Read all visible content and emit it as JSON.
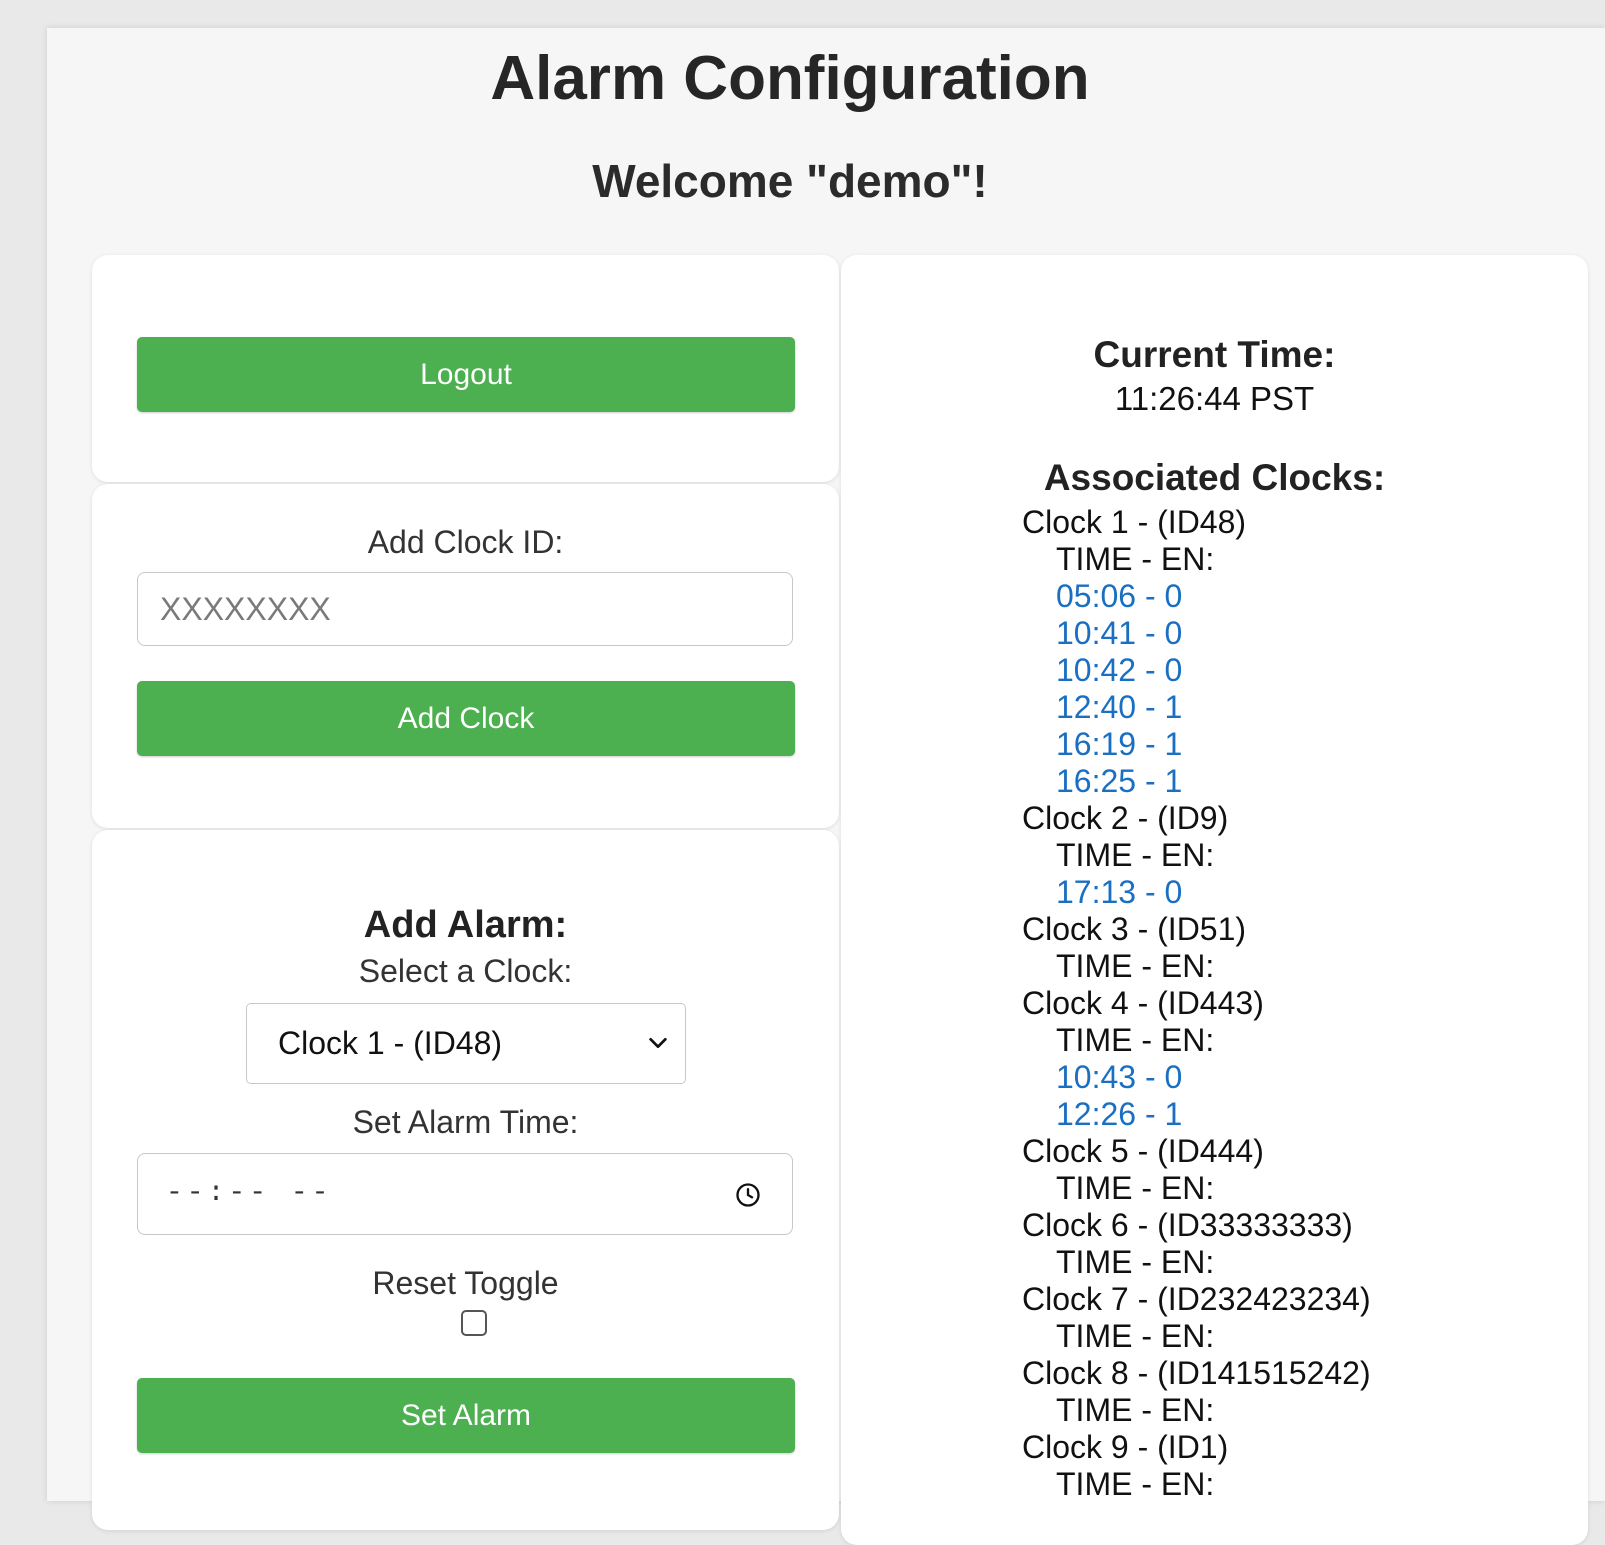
{
  "header": {
    "title": "Alarm Configuration",
    "welcome": "Welcome \"demo\"!"
  },
  "logout": {
    "button_label": "Logout"
  },
  "add_clock": {
    "label": "Add Clock ID:",
    "input_placeholder": "XXXXXXXX",
    "button_label": "Add Clock"
  },
  "add_alarm": {
    "heading": "Add Alarm:",
    "select_label": "Select a Clock:",
    "selected_clock": "Clock 1 - (ID48)",
    "time_label": "Set Alarm Time:",
    "time_placeholder": "--:-- --",
    "reset_label": "Reset Toggle",
    "reset_checked": false,
    "button_label": "Set Alarm"
  },
  "status": {
    "current_time_heading": "Current Time:",
    "current_time": "11:26:44 PST",
    "clocks_heading": "Associated Clocks:",
    "time_en_label": "TIME - EN:",
    "clocks": [
      {
        "name": "Clock 1 - (ID48)",
        "alarms": [
          "05:06 - 0",
          "10:41 - 0",
          "10:42 - 0",
          "12:40 - 1",
          "16:19 - 1",
          "16:25 - 1"
        ]
      },
      {
        "name": "Clock 2 - (ID9)",
        "alarms": [
          "17:13 - 0"
        ]
      },
      {
        "name": "Clock 3 - (ID51)",
        "alarms": []
      },
      {
        "name": "Clock 4 - (ID443)",
        "alarms": [
          "10:43 - 0",
          "12:26 - 1"
        ]
      },
      {
        "name": "Clock 5 - (ID444)",
        "alarms": []
      },
      {
        "name": "Clock 6 - (ID33333333)",
        "alarms": []
      },
      {
        "name": "Clock 7 - (ID232423234)",
        "alarms": []
      },
      {
        "name": "Clock 8 - (ID141515242)",
        "alarms": []
      },
      {
        "name": "Clock 9 - (ID1)",
        "alarms": []
      }
    ]
  },
  "colors": {
    "button_green": "#4caf50",
    "alarm_link_blue": "#1a6fc2"
  }
}
